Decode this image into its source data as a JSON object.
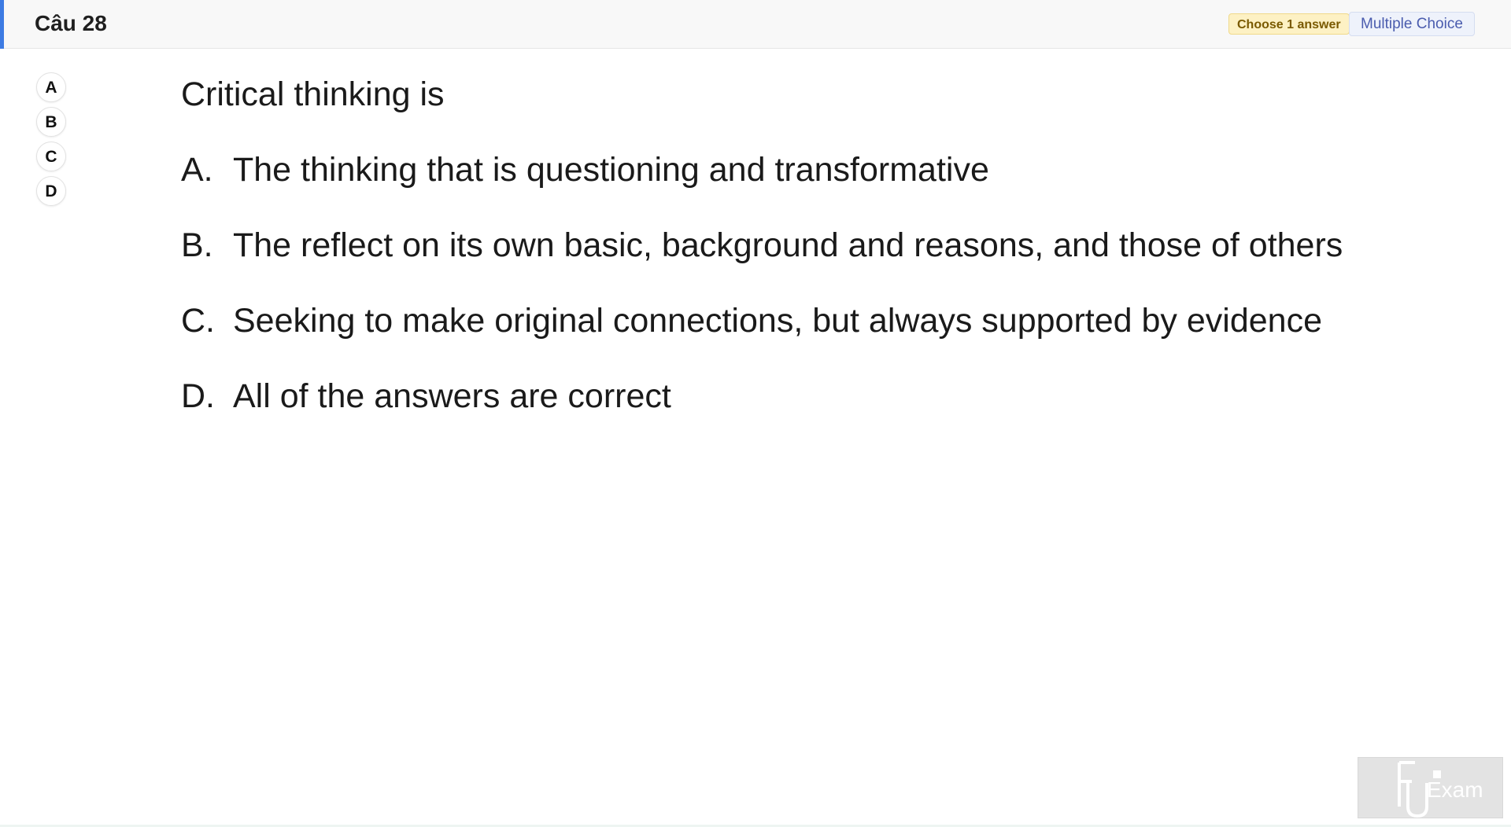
{
  "header": {
    "title": "Câu 28",
    "choose_badge": "Choose 1 answer",
    "type_badge": "Multiple Choice"
  },
  "answer_buttons": [
    "A",
    "B",
    "C",
    "D"
  ],
  "question": {
    "stem": "Critical thinking is",
    "options": [
      {
        "letter": "A.",
        "text": "The thinking that is questioning and transformative"
      },
      {
        "letter": "B.",
        "text": "The reflect on its own basic, background and reasons, and those of others"
      },
      {
        "letter": "C.",
        "text": "Seeking to make original connections, but always supported by evidence"
      },
      {
        "letter": "D.",
        "text": "All of the answers are correct"
      }
    ]
  },
  "logo": {
    "text": "Exam",
    "icon": "fu-exam-logo-icon"
  },
  "colors": {
    "accent": "#3d7be3",
    "badge_yellow_bg": "#fdf1c4",
    "badge_blue_text": "#4a5cae"
  }
}
